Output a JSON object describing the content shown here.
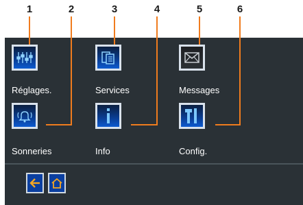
{
  "callout_numbers": [
    "1",
    "2",
    "3",
    "4",
    "5",
    "6"
  ],
  "menu": {
    "items": [
      {
        "label": "Réglages.",
        "icon": "equalizer-icon"
      },
      {
        "label": "Services",
        "icon": "documents-icon"
      },
      {
        "label": "Messages",
        "icon": "envelope-icon"
      },
      {
        "label": "Sonneries",
        "icon": "bell-icon"
      },
      {
        "label": "Info",
        "icon": "info-icon"
      },
      {
        "label": "Config.",
        "icon": "tools-icon"
      }
    ]
  },
  "nav": {
    "back_icon": "arrow-left-icon",
    "home_icon": "home-icon"
  },
  "colors": {
    "panel": "#2a3136",
    "accent": "#f07c1e",
    "tile_blue": "#0a3e94"
  }
}
